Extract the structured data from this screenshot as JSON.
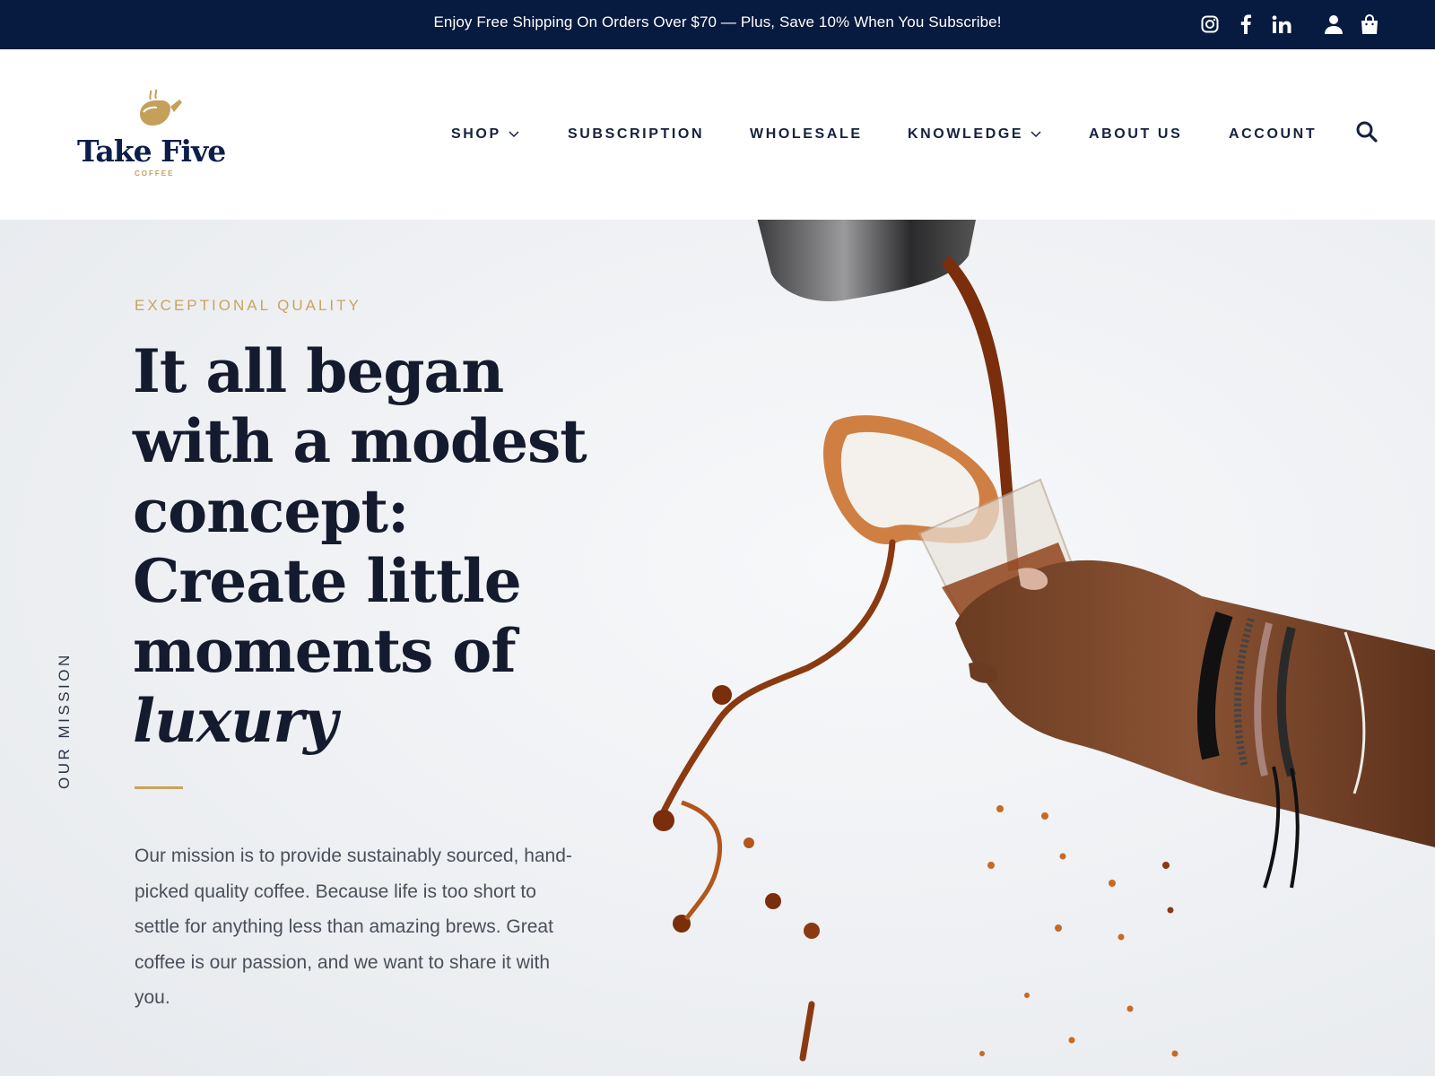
{
  "announcement": {
    "text": "Enjoy Free Shipping On Orders Over $70 — Plus, Save 10% When You Subscribe!"
  },
  "utility_icons": [
    "instagram-icon",
    "facebook-icon",
    "linkedin-icon",
    "account-icon",
    "cart-icon"
  ],
  "brand": {
    "name": "Take Five",
    "sub": "COFFEE"
  },
  "nav": {
    "items": [
      {
        "label": "SHOP",
        "dropdown": true
      },
      {
        "label": "SUBSCRIPTION",
        "dropdown": false
      },
      {
        "label": "WHOLESALE",
        "dropdown": false
      },
      {
        "label": "KNOWLEDGE",
        "dropdown": true
      },
      {
        "label": "ABOUT US",
        "dropdown": false
      },
      {
        "label": "ACCOUNT",
        "dropdown": false
      }
    ]
  },
  "hero": {
    "eyebrow": "EXCEPTIONAL QUALITY",
    "headline_lines": [
      "It all began",
      "with a modest",
      "concept:",
      "Create little",
      "moments of"
    ],
    "headline_italic": "luxury",
    "body": "Our mission is to provide sustainably sourced, hand-picked quality coffee. Because life is too short to settle for anything less than amazing brews. Great coffee is our passion, and we want to share it with you.",
    "side_label": "OUR MISSION"
  },
  "colors": {
    "topbar": "#071a3f",
    "navy": "#0b1f4a",
    "gold": "#c9a45f",
    "body_text": "#4a4f5a",
    "coffee": "#8a3a10"
  }
}
